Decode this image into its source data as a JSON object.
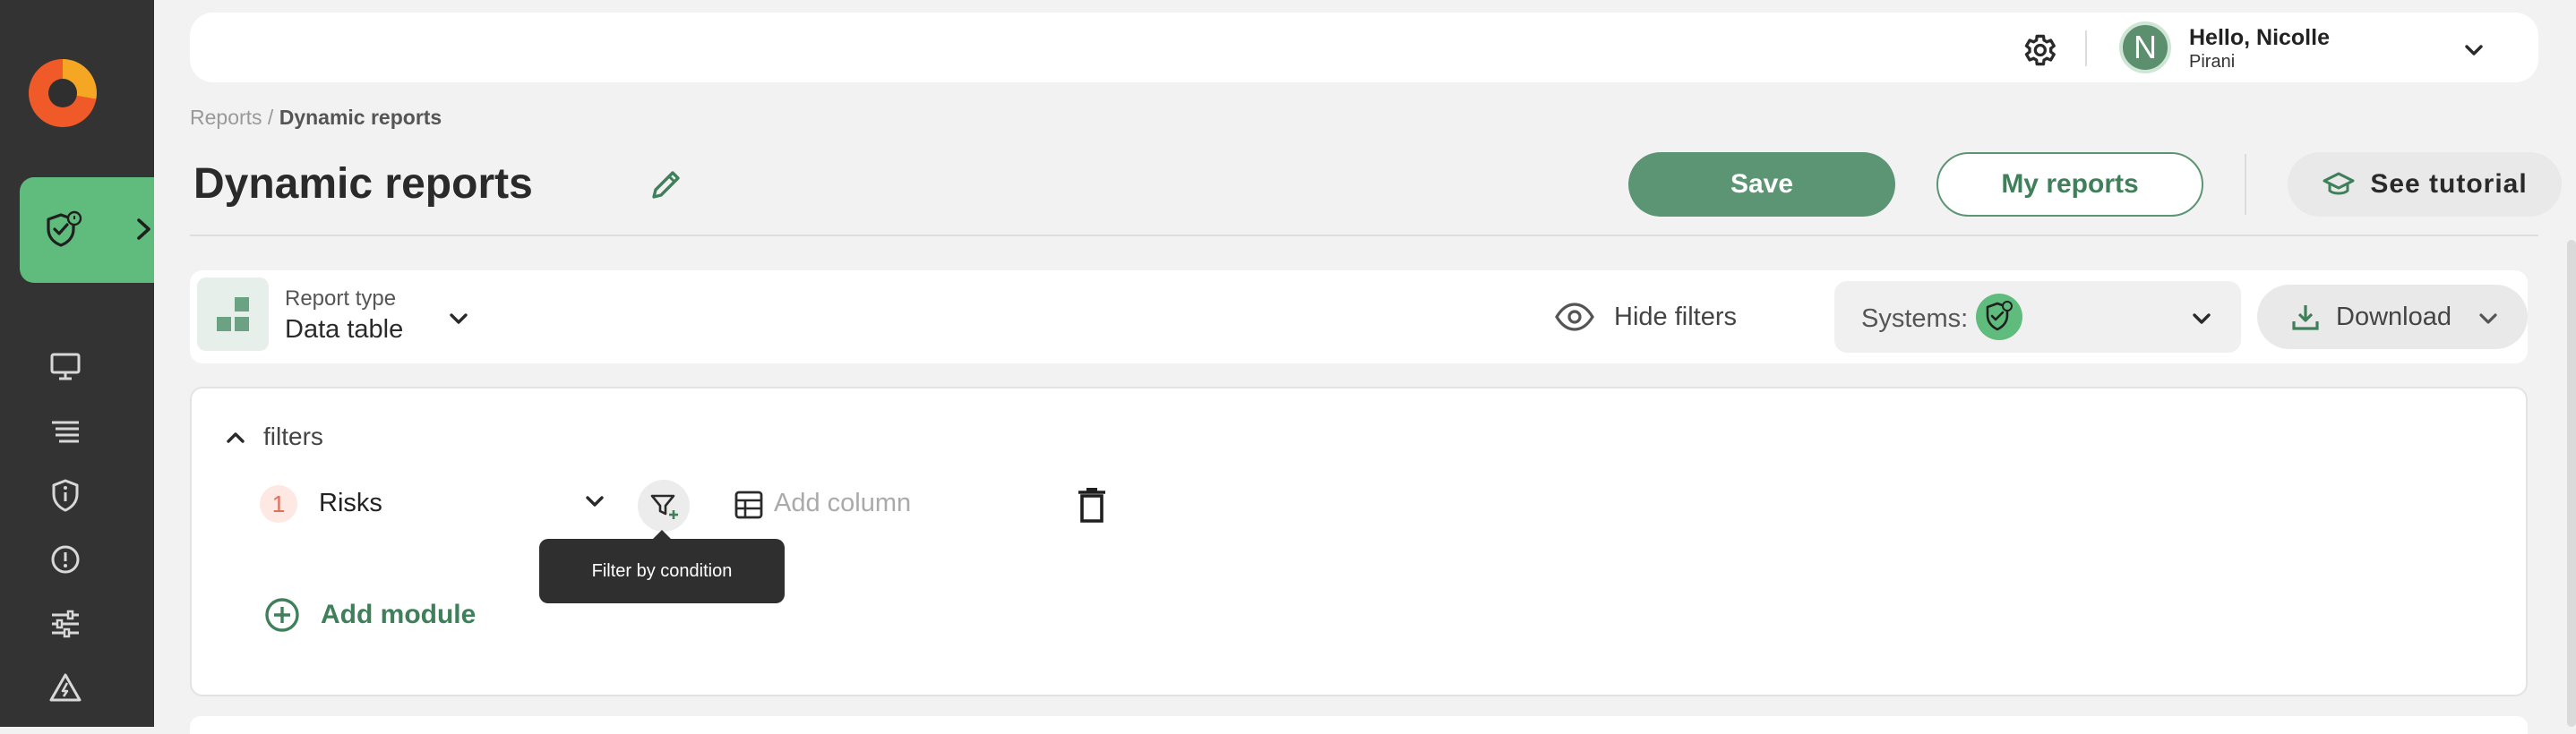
{
  "header": {
    "greeting": "Hello, Nicolle",
    "organization": "Pirani",
    "avatar_initial": "N"
  },
  "breadcrumb": {
    "parent": "Reports /",
    "current": "Dynamic reports"
  },
  "page": {
    "title": "Dynamic reports",
    "save_label": "Save",
    "my_reports_label": "My reports",
    "tutorial_label": "See tutorial"
  },
  "toolbar": {
    "report_type_label": "Report type",
    "report_type_value": "Data table",
    "hide_filters_label": "Hide filters",
    "systems_label": "Systems:",
    "download_label": "Download"
  },
  "filters": {
    "section_label": "filters",
    "modules": [
      {
        "number": "1",
        "name": "Risks"
      }
    ],
    "add_column_placeholder": "Add column",
    "tooltip": "Filter by condition",
    "add_module_label": "Add module"
  },
  "sidebar": {
    "icons": [
      "monitor-icon",
      "list-icon",
      "shield-info-icon",
      "alert-circle-icon",
      "sliders-icon",
      "warning-triangle-icon"
    ]
  },
  "colors": {
    "sidebar_bg": "#333333",
    "accent_green": "#5fbc7c",
    "primary_button": "#5b9574",
    "text_green": "#3f7f5a",
    "module_badge": "#e0705a"
  }
}
